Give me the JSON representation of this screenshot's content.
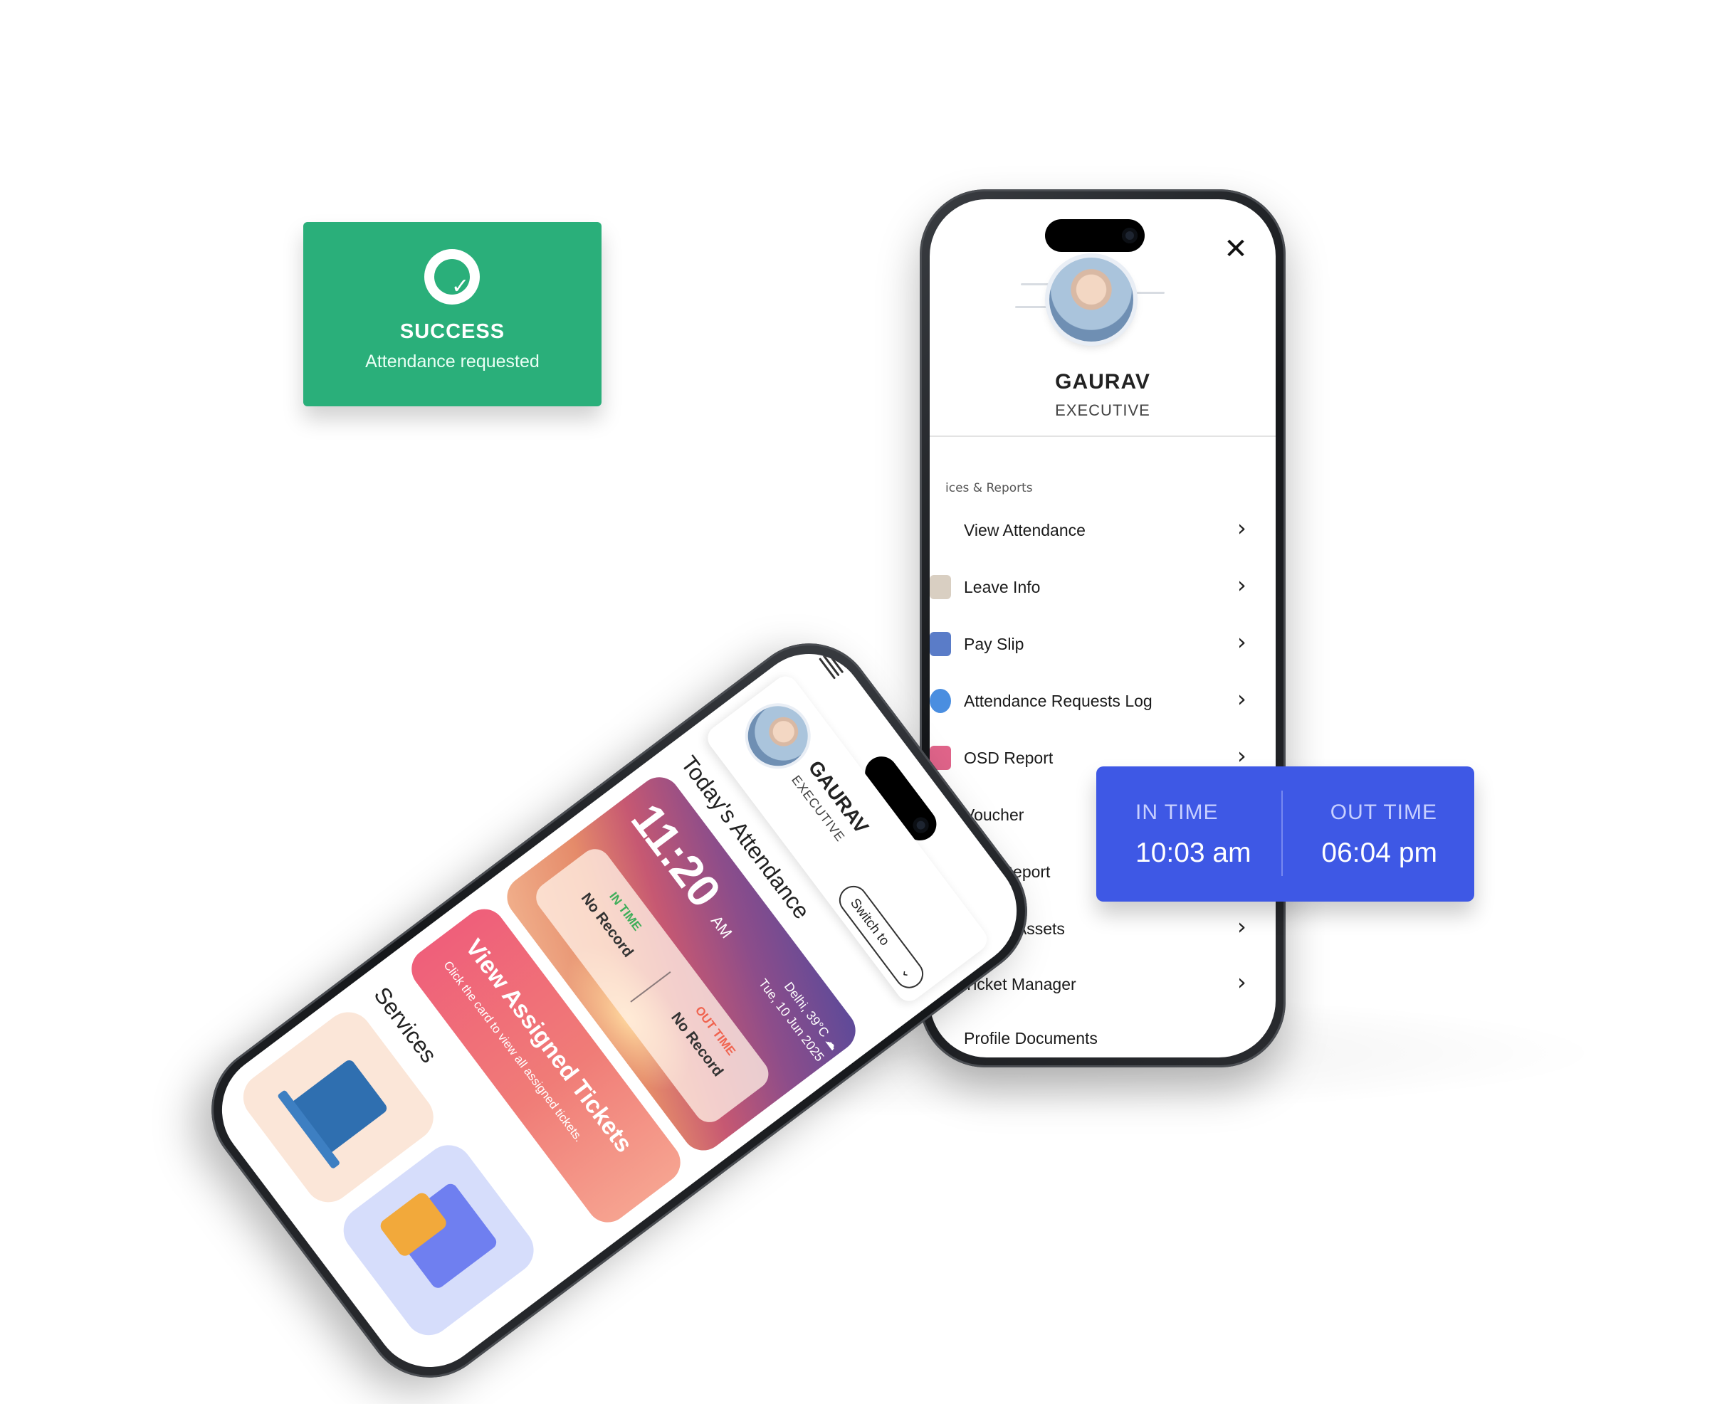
{
  "success_toast": {
    "title": "SUCCESS",
    "message": "Attendance requested",
    "icon": "check-circle-icon",
    "color": "#2aaf7a"
  },
  "time_card": {
    "in_label": "IN TIME",
    "in_value": "10:03 am",
    "out_label": "OUT TIME",
    "out_value": "06:04 pm",
    "color": "#3e58e5"
  },
  "left_phone": {
    "profile": {
      "name": "GAURAV",
      "role": "EXECUTIVE"
    },
    "switch_label": "Switch to",
    "todays_attendance": {
      "title": "Today's Attendance",
      "time": "11:20",
      "ampm": "AM",
      "location_temp": "Delhi, 39°C",
      "weather_icon": "cloud-icon",
      "date": "Tue, 10 Jun 2025",
      "in_time_label": "IN TIME",
      "in_time_value": "No Record",
      "out_time_label": "OUT TIME",
      "out_time_value": "No Record"
    },
    "tickets_card": {
      "title": "View Assigned Tickets",
      "subtitle": "Click the card to view all assigned tickets."
    },
    "services_title": "Services"
  },
  "right_phone": {
    "profile": {
      "name": "GAURAV",
      "role": "EXECUTIVE"
    },
    "section_label": "ices & Reports",
    "menu_items": [
      {
        "label": "View Attendance",
        "icon": "calendar-icon"
      },
      {
        "label": "Leave Info",
        "icon": "leave-icon"
      },
      {
        "label": "Pay Slip",
        "icon": "payslip-icon"
      },
      {
        "label": "Attendance Requests Log",
        "icon": "attendance-log-icon"
      },
      {
        "label": "OSD Report",
        "icon": "team-icon"
      },
      {
        "label": "Voucher",
        "icon": "voucher-icon"
      },
      {
        "label": "Shift Report",
        "icon": "shift-report-icon"
      },
      {
        "label": "Issued Assets",
        "icon": "assets-icon"
      },
      {
        "label": "Ticket Manager",
        "icon": "ticket-icon"
      },
      {
        "label": "Profile Documents",
        "icon": "documents-icon"
      }
    ]
  }
}
